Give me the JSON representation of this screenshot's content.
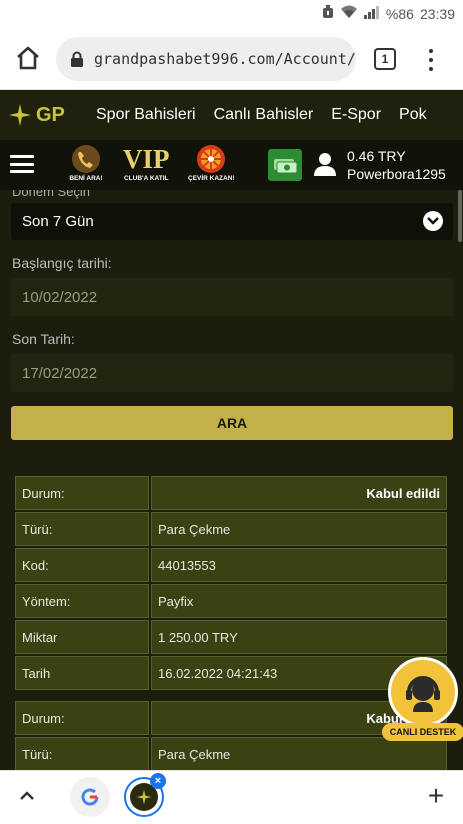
{
  "status_bar": {
    "battery": "%86",
    "time": "23:39"
  },
  "browser": {
    "url": "grandpashabet996.com/Account/",
    "tab_count": "1"
  },
  "site_nav": {
    "logo": "GP",
    "items": [
      "Spor Bahisleri",
      "Canlı Bahisler",
      "E-Spor",
      "Pok"
    ]
  },
  "sub_nav": {
    "promos": [
      "BENİ ARA!",
      "CLUB'A KATIL",
      "ÇEVİR KAZAN!"
    ],
    "vip_text": "VIP",
    "balance": "0.46 TRY",
    "username": "Powerbora1295"
  },
  "filter": {
    "period_label": "Dönem Seçin",
    "period_value": "Son 7 Gün",
    "start_label": "Başlangıç tarihi:",
    "start_value": "10/02/2022",
    "end_label": "Son Tarih:",
    "end_value": "17/02/2022",
    "search_button": "ARA"
  },
  "transactions": [
    {
      "rows": [
        {
          "key": "Durum:",
          "value": "Kabul edildi"
        },
        {
          "key": "Türü:",
          "value": "Para Çekme"
        },
        {
          "key": "Kod:",
          "value": "44013553"
        },
        {
          "key": "Yöntem:",
          "value": "Payfix"
        },
        {
          "key": "Miktar",
          "value": "1 250.00 TRY"
        },
        {
          "key": "Tarih",
          "value": "16.02.2022 04:21:43"
        }
      ]
    },
    {
      "rows": [
        {
          "key": "Durum:",
          "value": "Kabul edildi"
        },
        {
          "key": "Türü:",
          "value": "Para Çekme"
        }
      ]
    }
  ],
  "support": {
    "label": "CANLI DESTEK"
  },
  "colors": {
    "accent_gold": "#c5b14a",
    "cell_olive": "#3c4114",
    "page_dark": "#1c1d0c"
  }
}
